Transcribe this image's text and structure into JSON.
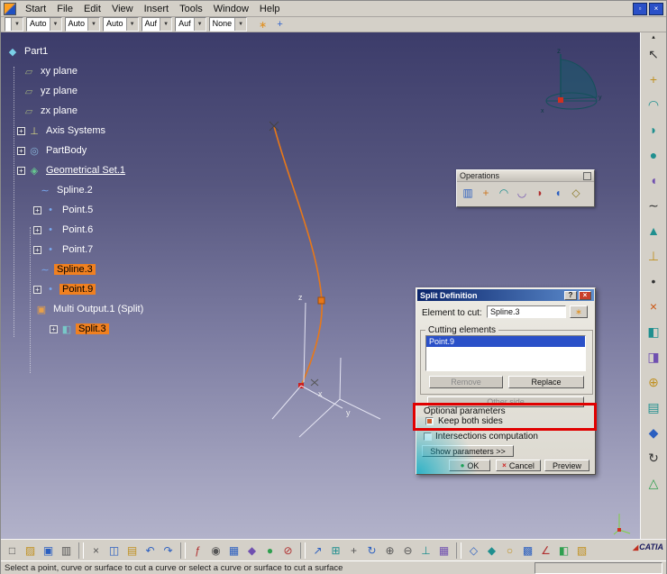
{
  "app": {
    "menu": [
      "Start",
      "File",
      "Edit",
      "View",
      "Insert",
      "Tools",
      "Window",
      "Help"
    ],
    "window_controls": [
      {
        "g": "▫",
        "n": "document-restore-icon"
      },
      {
        "g": "×",
        "n": "document-close-icon"
      }
    ]
  },
  "toolbar": {
    "combos": [
      {
        "v": ""
      },
      {
        "v": "Auto"
      },
      {
        "v": "Auto"
      },
      {
        "v": "Auto"
      },
      {
        "v": "Auf"
      },
      {
        "v": "Auf"
      },
      {
        "v": "None"
      }
    ],
    "buttons": [
      {
        "g": "∗",
        "c": "#e09020",
        "n": "graphic-properties-wizard-icon"
      },
      {
        "g": "+",
        "c": "#3366cc",
        "n": "painter-icon"
      }
    ],
    "arrow": "▾"
  },
  "tree": {
    "items": [
      {
        "label": "Part1",
        "pad": "2px",
        "glyph": "◆",
        "ic": "#7ad0e8",
        "cls": "",
        "plus": "hide"
      },
      {
        "label": "xy plane",
        "pad": "20px",
        "glyph": "▱",
        "ic": "#9aa87c",
        "cls": "",
        "plus": "hide"
      },
      {
        "label": "yz plane",
        "pad": "20px",
        "glyph": "▱",
        "ic": "#9aa87c",
        "cls": "",
        "plus": "hide"
      },
      {
        "label": "zx plane",
        "pad": "20px",
        "glyph": "▱",
        "ic": "#9aa87c",
        "cls": "",
        "plus": "hide"
      },
      {
        "label": "Axis Systems",
        "pad": "14px",
        "glyph": "⊥",
        "ic": "#d8d884",
        "cls": "",
        "plus": "show"
      },
      {
        "label": "PartBody",
        "pad": "14px",
        "glyph": "◎",
        "ic": "#88b4d8",
        "cls": "",
        "plus": "show"
      },
      {
        "label": "Geometrical Set.1",
        "pad": "14px",
        "glyph": "◈",
        "ic": "#66c890",
        "cls": "und",
        "plus": "show"
      },
      {
        "label": "Spline.2",
        "pad": "38px",
        "glyph": "∼",
        "ic": "#78a8f0",
        "cls": "",
        "plus": "hide"
      },
      {
        "label": "Point.5",
        "pad": "32px",
        "glyph": "•",
        "ic": "#78a8f0",
        "cls": "",
        "plus": "show"
      },
      {
        "label": "Point.6",
        "pad": "32px",
        "glyph": "•",
        "ic": "#78a8f0",
        "cls": "",
        "plus": "show"
      },
      {
        "label": "Point.7",
        "pad": "32px",
        "glyph": "•",
        "ic": "#78a8f0",
        "cls": "",
        "plus": "show"
      },
      {
        "label": "Spline.3",
        "pad": "38px",
        "glyph": "∼",
        "ic": "#78a8f0",
        "cls": "sel",
        "plus": "hide"
      },
      {
        "label": "Point.9",
        "pad": "32px",
        "glyph": "•",
        "ic": "#78a8f0",
        "cls": "sel",
        "plus": "show"
      },
      {
        "label": "Multi Output.1 (Split)",
        "pad": "34px",
        "glyph": "▣",
        "ic": "#e8a048",
        "cls": "",
        "plus": "hide"
      },
      {
        "label": "Split.3",
        "pad": "50px",
        "glyph": "◧",
        "ic": "#78c8c8",
        "cls": "sel",
        "plus": "show"
      }
    ]
  },
  "viewport": {
    "axis_labels": {
      "z": "z",
      "x": "x",
      "y": "y"
    },
    "colors": {
      "curve": "#e87818",
      "selected_point": "#e87818",
      "end_point": "#cc2020",
      "selection_highlight": "#f08020"
    }
  },
  "operations": {
    "title": "Operations",
    "icons": [
      {
        "g": "▥",
        "c": "#2b5fc0",
        "n": "join-icon"
      },
      {
        "g": "+",
        "c": "#cc7722",
        "n": "healing-icon"
      },
      {
        "g": "◠",
        "c": "#1f8f8f",
        "n": "curve-smooth-icon"
      },
      {
        "g": "◡",
        "c": "#7050b0",
        "n": "untrim-icon"
      },
      {
        "g": "◗",
        "c": "#b03030",
        "n": "split-icon"
      },
      {
        "g": "◖",
        "c": "#2b5fc0",
        "n": "trim-icon"
      },
      {
        "g": "◇",
        "c": "#887722",
        "n": "boundary-icon"
      }
    ]
  },
  "dialog": {
    "title": "Split Definition",
    "help_button": "?",
    "close_button": "×",
    "element_to_cut_label": "Element to cut:",
    "element_to_cut_value": "Spline.3",
    "field_icon": "∗",
    "cutting_elements_label": "Cutting elements",
    "cutting_elements": [
      {
        "label": "Point.9",
        "cls": "row-sel"
      }
    ],
    "remove_label": "Remove",
    "replace_label": "Replace",
    "other_side_label": "Other side",
    "optional_parameters_label": "Optional parameters",
    "keep_both_sides_label": "Keep both sides",
    "keep_both_sides_checked": true,
    "intersections_label": "Intersections computation",
    "intersections_checked": false,
    "show_parameters_label": "Show parameters >>",
    "ok_label": "OK",
    "ok_icon": "●",
    "cancel_label": "Cancel",
    "cancel_icon": "×",
    "preview_label": "Preview",
    "annotation_color": "#e00000"
  },
  "right_toolbar": {
    "scroll_arrow": "▴",
    "icons": [
      {
        "g": "↖",
        "c": "#333333",
        "n": "cursor-icon"
      },
      {
        "g": "+",
        "c": "#c09020",
        "n": "point-icon"
      },
      {
        "g": "◠",
        "c": "#1f8f8f",
        "n": "line-icon"
      },
      {
        "g": "◗",
        "c": "#1f8f8f",
        "n": "extrude-icon"
      },
      {
        "g": "●",
        "c": "#1f8f8f",
        "n": "revolve-icon"
      },
      {
        "g": "◖",
        "c": "#7050b0",
        "n": "sphere-icon"
      },
      {
        "g": "∼",
        "c": "#333333",
        "n": "spline-icon"
      },
      {
        "g": "▲",
        "c": "#1f8f8f",
        "n": "sweep-icon"
      },
      {
        "g": "⊥",
        "c": "#c09020",
        "n": "plane-icon"
      },
      {
        "g": "•",
        "c": "#333333",
        "n": "projection-icon"
      },
      {
        "g": "×",
        "c": "#cc5511",
        "n": "intersection-icon"
      },
      {
        "g": "◧",
        "c": "#1f8f8f",
        "n": "split-icon"
      },
      {
        "g": "◨",
        "c": "#7050b0",
        "n": "trim-icon"
      },
      {
        "g": "⊕",
        "c": "#c09020",
        "n": "boundary-icon"
      },
      {
        "g": "▤",
        "c": "#1f8f8f",
        "n": "extract-icon"
      },
      {
        "g": "◆",
        "c": "#2b5fc0",
        "n": "fill-icon"
      },
      {
        "g": "↻",
        "c": "#333333",
        "n": "rotate-tool-icon"
      },
      {
        "g": "△",
        "c": "#2f9f4f",
        "n": "scale-icon"
      }
    ]
  },
  "bottom_toolbar": {
    "icons": [
      {
        "g": "□",
        "c": "#555555",
        "n": "new-document-icon"
      },
      {
        "g": "▨",
        "c": "#c09020",
        "n": "open-icon"
      },
      {
        "g": "▣",
        "c": "#2b5fc0",
        "n": "save-icon"
      },
      {
        "g": "▥",
        "c": "#555555",
        "n": "print-icon"
      },
      {
        "g": "",
        "c": "",
        "n": "divider",
        "cls": "divider"
      },
      {
        "g": "×",
        "c": "#555555",
        "n": "cut-icon"
      },
      {
        "g": "◫",
        "c": "#2b5fc0",
        "n": "copy-icon"
      },
      {
        "g": "▤",
        "c": "#c09020",
        "n": "paste-icon"
      },
      {
        "g": "↶",
        "c": "#2b5fc0",
        "n": "undo-icon"
      },
      {
        "g": "↷",
        "c": "#2b5fc0",
        "n": "redo-icon"
      },
      {
        "g": "",
        "c": "",
        "n": "divider",
        "cls": "divider"
      },
      {
        "g": "ƒ",
        "c": "#b03030",
        "n": "formula-icon"
      },
      {
        "g": "◉",
        "c": "#555555",
        "n": "eye-icon"
      },
      {
        "g": "▦",
        "c": "#2b5fc0",
        "n": "table-icon"
      },
      {
        "g": "◆",
        "c": "#7050b0",
        "n": "graph-icon"
      },
      {
        "g": "●",
        "c": "#2f9f4f",
        "n": "globe-icon"
      },
      {
        "g": "⊘",
        "c": "#b03030",
        "n": "rules-icon"
      },
      {
        "g": "",
        "c": "",
        "n": "divider",
        "cls": "divider"
      },
      {
        "g": "↗",
        "c": "#2b5fc0",
        "n": "fly-icon"
      },
      {
        "g": "⊞",
        "c": "#1f8f8f",
        "n": "fit-all-icon"
      },
      {
        "g": "+",
        "c": "#555555",
        "n": "pan-icon"
      },
      {
        "g": "↻",
        "c": "#2b5fc0",
        "n": "rotate-view-icon"
      },
      {
        "g": "⊕",
        "c": "#555555",
        "n": "zoom-in-icon"
      },
      {
        "g": "⊖",
        "c": "#555555",
        "n": "zoom-out-icon"
      },
      {
        "g": "⊥",
        "c": "#1f8f8f",
        "n": "normal-view-icon"
      },
      {
        "g": "▦",
        "c": "#7050b0",
        "n": "multi-view-icon"
      },
      {
        "g": "",
        "c": "",
        "n": "divider",
        "cls": "divider"
      },
      {
        "g": "◇",
        "c": "#2b5fc0",
        "n": "wireframe-icon"
      },
      {
        "g": "◆",
        "c": "#1f8f8f",
        "n": "shaded-icon"
      },
      {
        "g": "○",
        "c": "#c09020",
        "n": "lighting-icon"
      },
      {
        "g": "▩",
        "c": "#2b5fc0",
        "n": "grid-icon"
      },
      {
        "g": "∠",
        "c": "#b03030",
        "n": "measure-icon"
      },
      {
        "g": "◧",
        "c": "#2f9f4f",
        "n": "paint-icon"
      },
      {
        "g": "▧",
        "c": "#c09020",
        "n": "catalog-icon"
      }
    ]
  },
  "footer": {
    "status_text": "Select a point, curve or surface to cut a curve or select a curve or surface to cut a surface",
    "logo_text": "CATIA",
    "logo_mark": "◢"
  }
}
